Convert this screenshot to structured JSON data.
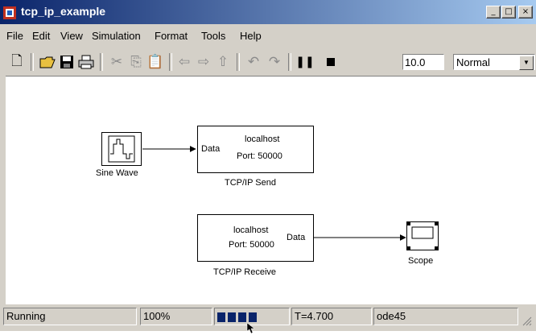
{
  "window": {
    "title": "tcp_ip_example",
    "controls": {
      "minimize": "_",
      "maximize": "□",
      "close": "×"
    }
  },
  "menubar": [
    "File",
    "Edit",
    "View",
    "Simulation",
    "Format",
    "Tools",
    "Help"
  ],
  "toolbar": {
    "stop_time": "10.0",
    "mode": "Normal"
  },
  "model": {
    "sine_wave": {
      "label": "Sine Wave"
    },
    "tcpip_send": {
      "host": "localhost",
      "port": "Port: 50000",
      "input_port": "Data",
      "label": "TCP/IP Send"
    },
    "tcpip_receive": {
      "host": "localhost",
      "port": "Port: 50000",
      "output_port": "Data",
      "label": "TCP/IP Receive"
    },
    "scope": {
      "label": "Scope"
    }
  },
  "statusbar": {
    "state": "Running",
    "zoom": "100%",
    "progress_fraction": 0.5,
    "time": "T=4.700",
    "solver": "ode45"
  },
  "colors": {
    "title_start": "#0a246a",
    "title_end": "#a6caf0",
    "chrome": "#d4d0c8",
    "progress": "#0a246a"
  }
}
